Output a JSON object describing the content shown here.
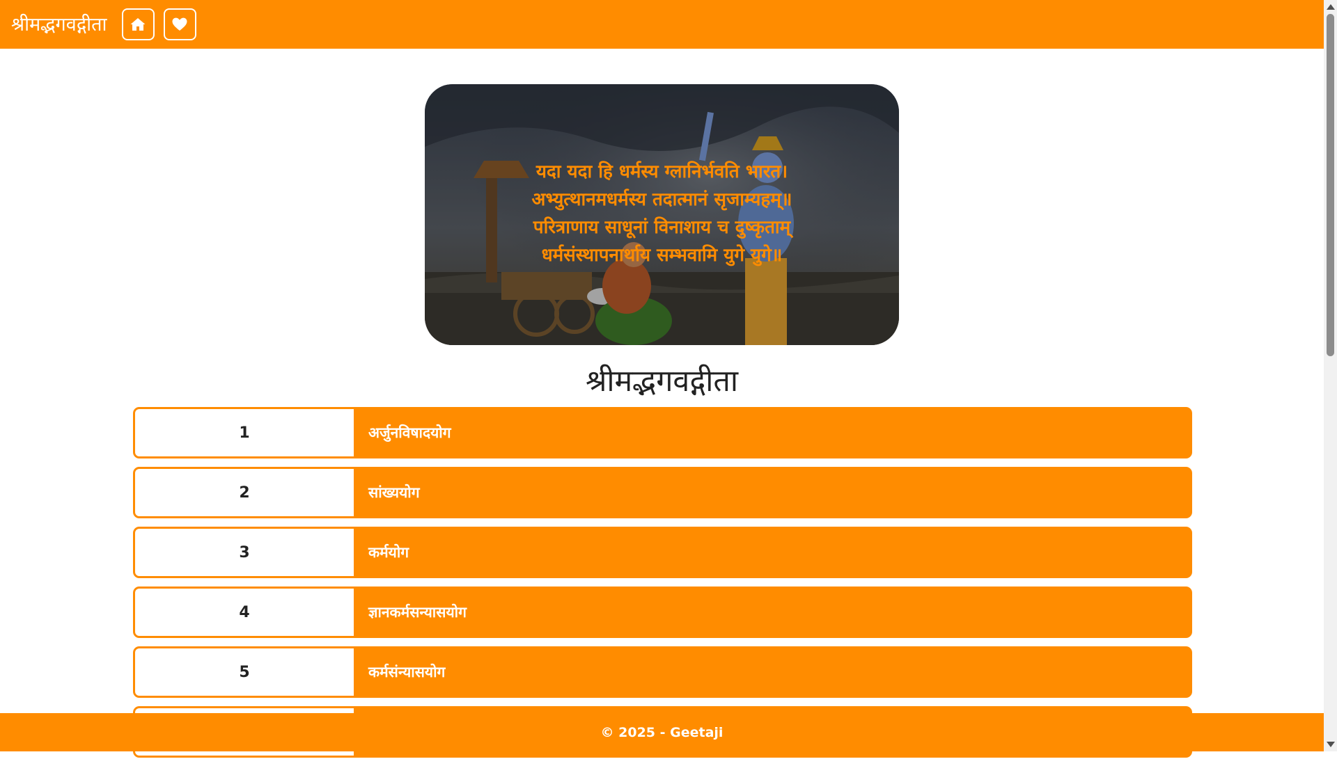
{
  "navbar": {
    "brand": "श्रीमद्भगवद्गीता",
    "home_icon": "home-icon",
    "favorites_icon": "heart-icon"
  },
  "hero": {
    "shloka_lines": [
      "यदा यदा हि धर्मस्य ग्लानिर्भवति भारत।",
      "अभ्युत्थानमधर्मस्य तदात्मानं सृजाम्यहम्॥",
      "परित्राणाय साधूनां विनाशाय च दुष्कृताम्",
      "धर्मसंस्थापनार्थाय सम्भवामि युगे युगे॥"
    ]
  },
  "page_title": "श्रीमद्भगवद्गीता",
  "chapters": [
    {
      "number": "1",
      "name": "अर्जुनविषादयोग"
    },
    {
      "number": "2",
      "name": "सांख्ययोग"
    },
    {
      "number": "3",
      "name": "कर्मयोग"
    },
    {
      "number": "4",
      "name": "ज्ञानकर्मसन्यासयोग"
    },
    {
      "number": "5",
      "name": "कर्मसंन्यासयोग"
    },
    {
      "number": "",
      "name": ""
    }
  ],
  "footer": {
    "text": "© 2025 - Geetaji"
  },
  "colors": {
    "accent": "#ff8c00",
    "background": "#ffffff",
    "text": "#222222"
  }
}
